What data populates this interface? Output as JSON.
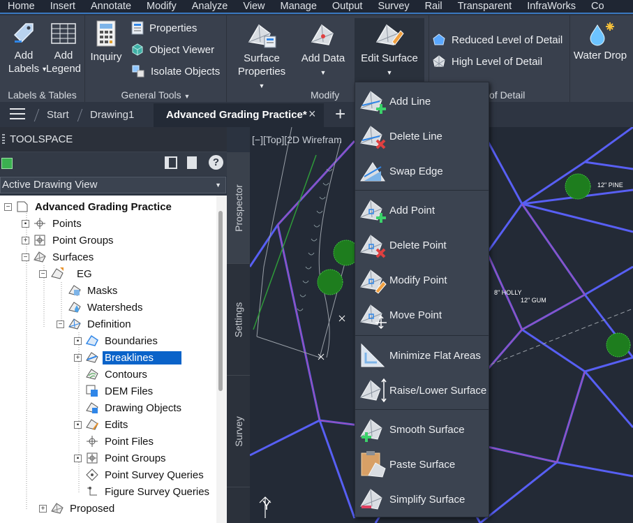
{
  "menubar": {
    "tabs": [
      "Home",
      "Insert",
      "Annotate",
      "Modify",
      "Analyze",
      "View",
      "Manage",
      "Output",
      "Survey",
      "Rail",
      "Transparent",
      "InfraWorks",
      "Co"
    ]
  },
  "ribbon": {
    "labels_tables": {
      "title": "Labels & Tables",
      "add_labels": [
        "Add",
        "Labels"
      ],
      "add_legend": [
        "Add",
        "Legend"
      ]
    },
    "general_tools": {
      "title": "General Tools",
      "inquiry": "Inquiry",
      "properties": "Properties",
      "object_viewer": "Object Viewer",
      "isolate_objects": "Isolate Objects"
    },
    "modify": {
      "title": "Modify",
      "surface_properties": [
        "Surface",
        "Properties"
      ],
      "add_data": "Add Data",
      "edit_surface": "Edit Surface"
    },
    "lod": {
      "title_fragment": "of Detail",
      "reduced": "Reduced Level of Detail",
      "high": "High Level of Detail"
    },
    "water_drop": "Water Drop"
  },
  "doctabs": {
    "start": "Start",
    "drawing1": "Drawing1",
    "active": "Advanced Grading Practice*"
  },
  "toolspace": {
    "title": "TOOLSPACE",
    "view_select": "Active Drawing View",
    "side_tabs": [
      "Prospector",
      "Settings",
      "Survey"
    ]
  },
  "tree": [
    {
      "label": "Advanced Grading Practice",
      "bold": true
    },
    {
      "label": "Points"
    },
    {
      "label": "Point Groups"
    },
    {
      "label": "Surfaces"
    },
    {
      "label": "EG"
    },
    {
      "label": "Masks"
    },
    {
      "label": "Watersheds"
    },
    {
      "label": "Definition"
    },
    {
      "label": "Boundaries"
    },
    {
      "label": "Breaklines",
      "selected": true
    },
    {
      "label": "Contours"
    },
    {
      "label": "DEM Files"
    },
    {
      "label": "Drawing Objects"
    },
    {
      "label": "Edits"
    },
    {
      "label": "Point Files"
    },
    {
      "label": "Point Groups"
    },
    {
      "label": "Point Survey Queries"
    },
    {
      "label": "Figure Survey Queries"
    },
    {
      "label": "Proposed"
    }
  ],
  "viewport": {
    "label": "[−][Top][2D Wirefram",
    "annotations": [
      "12\" PINE",
      "8\" HOLLY",
      "12\" GUM"
    ],
    "ucs_y": "Y"
  },
  "edit_surface_menu": [
    {
      "label": "Add Line",
      "icon": "add-line-icon"
    },
    {
      "label": "Delete Line",
      "icon": "delete-line-icon"
    },
    {
      "label": "Swap Edge",
      "icon": "swap-edge-icon"
    },
    {
      "label": "Add Point",
      "icon": "add-point-icon"
    },
    {
      "label": "Delete Point",
      "icon": "delete-point-icon"
    },
    {
      "label": "Modify Point",
      "icon": "modify-point-icon"
    },
    {
      "label": "Move Point",
      "icon": "move-point-icon"
    },
    {
      "label": "Minimize Flat Areas",
      "icon": "minimize-flat-areas-icon"
    },
    {
      "label": "Raise/Lower Surface",
      "icon": "raise-lower-surface-icon"
    },
    {
      "label": "Smooth Surface",
      "icon": "smooth-surface-icon"
    },
    {
      "label": "Paste Surface",
      "icon": "paste-surface-icon"
    },
    {
      "label": "Simplify Surface",
      "icon": "simplify-surface-icon"
    }
  ]
}
